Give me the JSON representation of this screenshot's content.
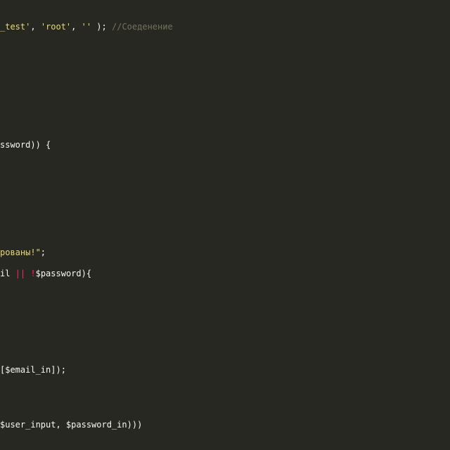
{
  "colors": {
    "background": "#272822",
    "string": "#e6db74",
    "plain": "#f8f8f2",
    "comment": "#75715e",
    "operator": "#f92672"
  },
  "code": {
    "line1": {
      "str1": "_test'",
      "sep1": ", ",
      "str2": "'root'",
      "sep2": ", ",
      "str3": "''",
      "close": " );",
      "comment": " //Соеденение"
    },
    "line2": {
      "text": "ssword)) {"
    },
    "line3": {
      "str": "рованы!\"",
      "end": ";"
    },
    "line4": {
      "pre": "il ",
      "op1": "||",
      "space": " ",
      "op2": "!",
      "post": "$password){"
    },
    "line5": {
      "text": "[$email_in]);"
    },
    "line6": {
      "text": "$user_input, $password_in)))"
    }
  }
}
